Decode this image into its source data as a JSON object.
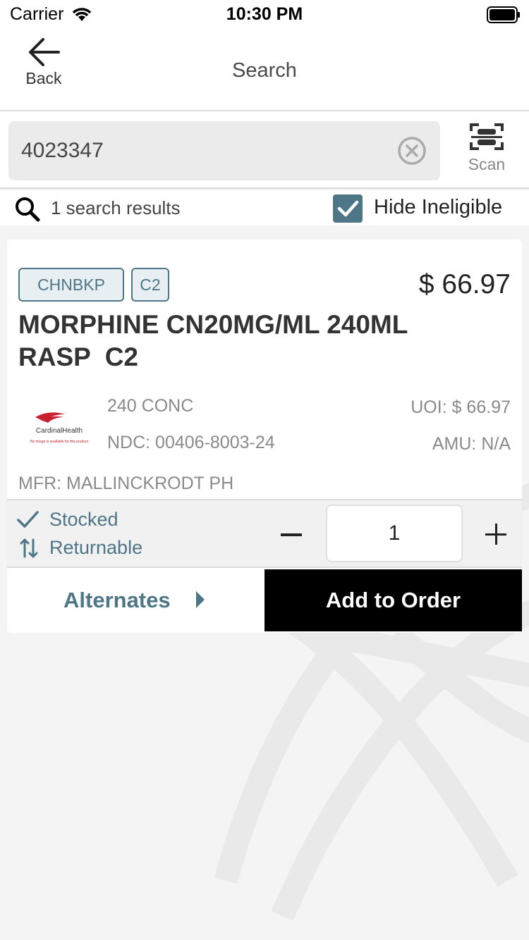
{
  "status_bar": {
    "carrier": "Carrier",
    "time": "10:30 PM",
    "wifi_icon": "wifi-icon",
    "battery_icon": "battery-full-icon"
  },
  "nav": {
    "back_label": "Back",
    "title": "Search",
    "back_icon": "arrow-left-icon"
  },
  "search": {
    "value": "4023347",
    "clear_icon": "clear-circle-icon",
    "scan_label": "Scan",
    "scan_icon": "barcode-scan-icon"
  },
  "results": {
    "count_text": "1 search results",
    "hide_ineligible_label": "Hide Ineligible",
    "hide_ineligible_checked": true,
    "search_icon": "magnifier-icon"
  },
  "product": {
    "badges": [
      "CHNBKP",
      "C2"
    ],
    "price": "$ 66.97",
    "name": "MORPHINE CN20MG/ML 240ML\nRASP  C2",
    "thumb_logo_text": "CardinalHealth",
    "thumb_caption": "No image is available for this product",
    "package": "240 CONC",
    "ndc": "NDC: 00406-8003-24",
    "uoi": "UOI: $ 66.97",
    "amu": "AMU: N/A",
    "mfr": "MFR: MALLINCKRODT PH",
    "stocked_label": "Stocked",
    "returnable_label": "Returnable",
    "quantity": "1",
    "alternates_label": "Alternates",
    "add_to_order_label": "Add to Order"
  },
  "colors": {
    "accent": "#4e7686",
    "primary_button": "#000000",
    "background": "#f4f4f4"
  }
}
